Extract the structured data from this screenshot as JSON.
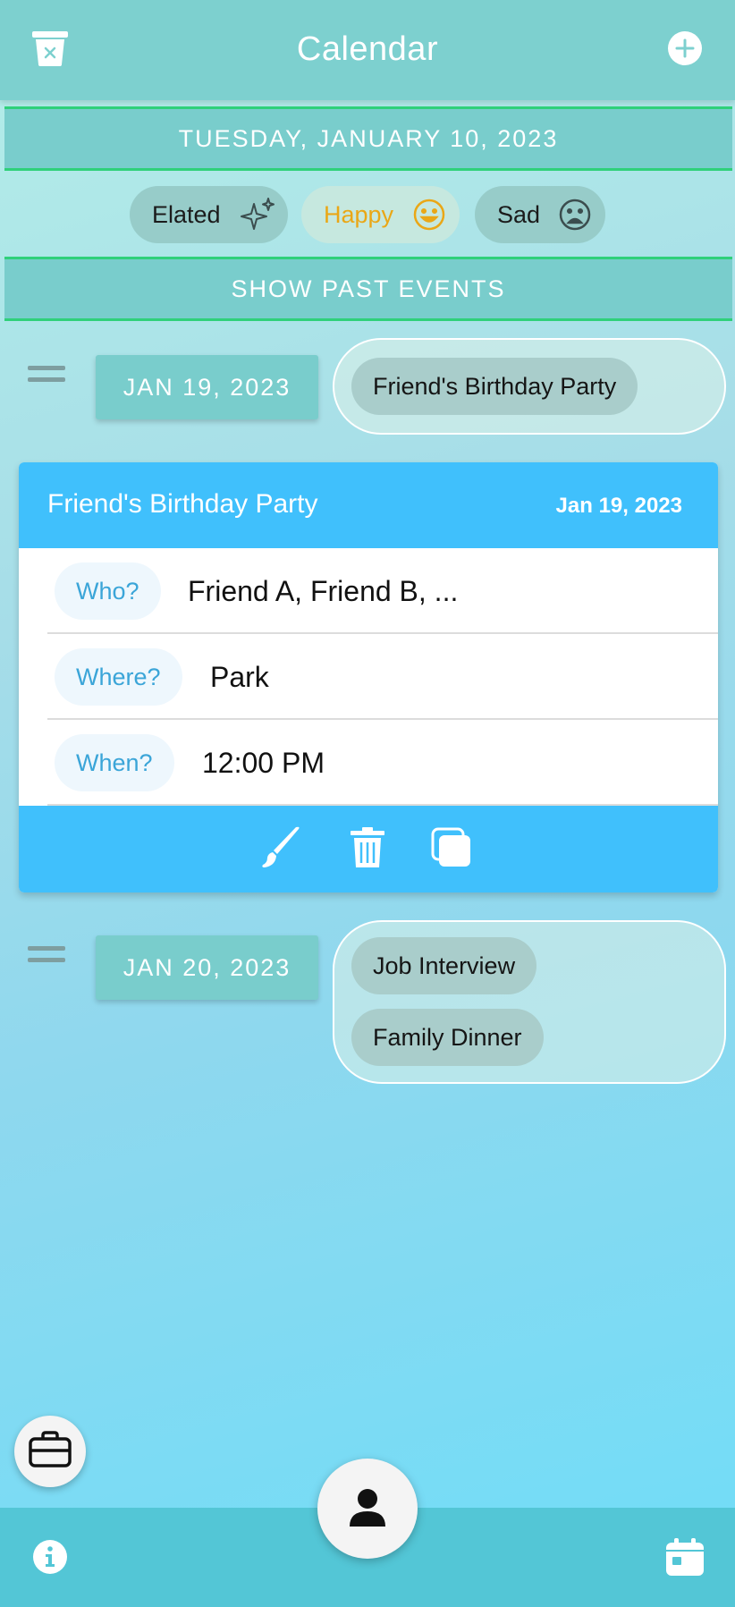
{
  "header": {
    "title": "Calendar",
    "left_icon": "trash-clear-icon",
    "right_icon": "add-circle-icon"
  },
  "selected_date": "TUESDAY, JANUARY 10, 2023",
  "moods": [
    {
      "label": "Elated",
      "icon": "sparkles-icon"
    },
    {
      "label": "Happy",
      "icon": "smile-icon",
      "color": "#eaa716"
    },
    {
      "label": "Sad",
      "icon": "frown-icon"
    }
  ],
  "show_past_label": "SHOW PAST EVENTS",
  "days": [
    {
      "date_label": "JAN 19, 2023",
      "events": [
        "Friend's Birthday Party"
      ]
    },
    {
      "date_label": "JAN 20, 2023",
      "events": [
        "Job Interview",
        "Family Dinner"
      ]
    }
  ],
  "event_card": {
    "title": "Friend's Birthday Party",
    "date": "Jan 19, 2023",
    "rows": [
      {
        "label": "Who?",
        "value": "Friend A, Friend B, ..."
      },
      {
        "label": "Where?",
        "value": "Park"
      },
      {
        "label": "When?",
        "value": "12:00 PM"
      }
    ],
    "actions": [
      "edit-brush-icon",
      "delete-trash-icon",
      "duplicate-copy-icon"
    ],
    "accent": "#40c0fc"
  },
  "nav": {
    "left_fab_icon": "briefcase-icon",
    "center_fab_icon": "person-icon",
    "left_icon": "info-icon",
    "right_icon": "calendar-icon"
  },
  "colors": {
    "header": "#7dd0cf",
    "bar_border": "#2fd07a",
    "nav": "#53c6d6"
  }
}
